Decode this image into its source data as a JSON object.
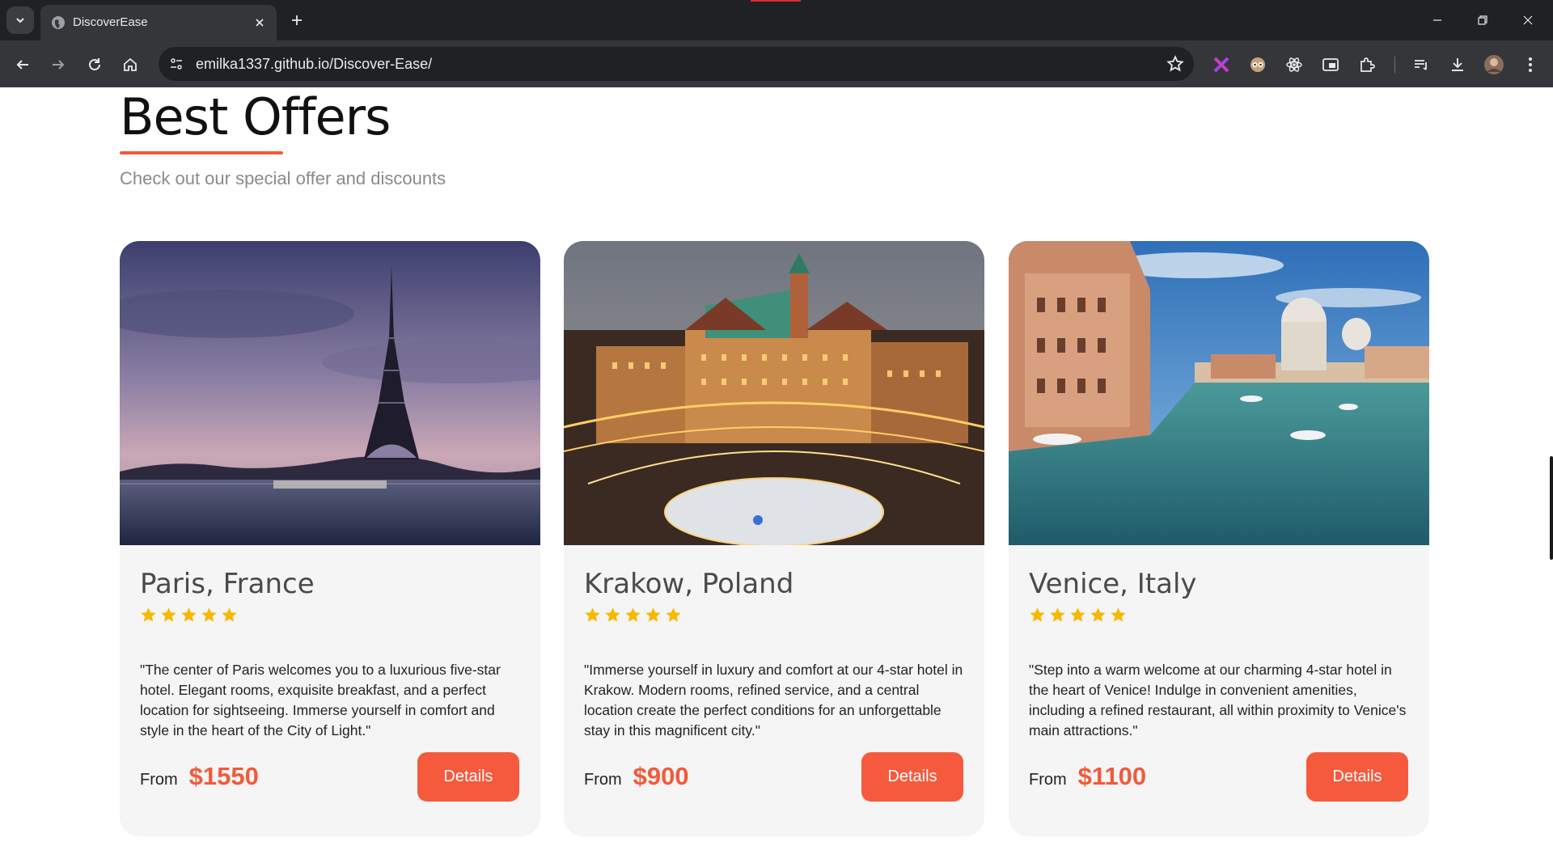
{
  "browser": {
    "tab_title": "DiscoverEase",
    "url": "emilka1337.github.io/Discover-Ease/"
  },
  "section": {
    "title": "Best Offers",
    "subtitle": "Check out our special offer and discounts"
  },
  "offers": [
    {
      "title": "Paris, France",
      "rating": 5,
      "description": "\"The center of Paris welcomes you to a luxurious five-star hotel. Elegant rooms, exquisite breakfast, and a perfect location for sightseeing. Immerse yourself in comfort and style in the heart of the City of Light.\"",
      "from_label": "From",
      "price": "$1550",
      "button_label": "Details"
    },
    {
      "title": "Krakow, Poland",
      "rating": 5,
      "description": "\"Immerse yourself in luxury and comfort at our 4-star hotel in Krakow. Modern rooms, refined service, and a central location create the perfect conditions for an unforgettable stay in this magnificent city.\"",
      "from_label": "From",
      "price": "$900",
      "button_label": "Details"
    },
    {
      "title": "Venice, Italy",
      "rating": 5,
      "description": "\"Step into a warm welcome at our charming 4-star hotel in the heart of Venice! Indulge in convenient amenities, including a refined restaurant, all within proximity to Venice's main attractions.\"",
      "from_label": "From",
      "price": "$1100",
      "button_label": "Details"
    }
  ],
  "colors": {
    "accent": "#f15a3a",
    "star": "#f6b800",
    "card_bg": "#f5f5f5"
  }
}
